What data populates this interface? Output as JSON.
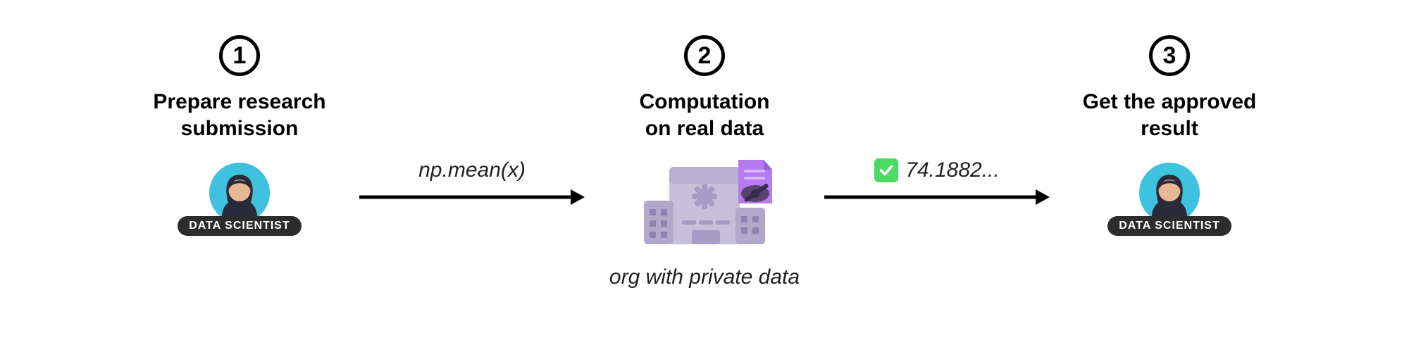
{
  "steps": [
    {
      "number": "1",
      "title_line1": "Prepare research",
      "title_line2": "submission"
    },
    {
      "number": "2",
      "title_line1": "Computation",
      "title_line2": "on real data"
    },
    {
      "number": "3",
      "title_line1": "Get the approved",
      "title_line2": "result"
    }
  ],
  "arrow1": {
    "label": "np.mean(x)"
  },
  "arrow2": {
    "result": "74.1882..."
  },
  "actor_label": "DATA SCIENTIST",
  "org_caption": "org with private data"
}
